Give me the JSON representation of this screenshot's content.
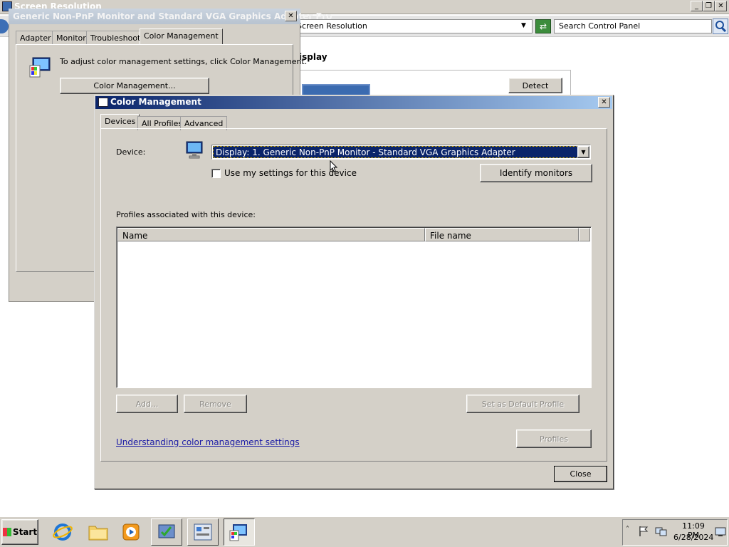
{
  "background_window": {
    "title": "Screen Resolution",
    "address": "Screen Resolution",
    "search_placeholder": "Search Control Panel",
    "heading_fragment": "isplay",
    "detect_label": "Detect"
  },
  "properties_dialog": {
    "title": "Generic Non-PnP Monitor and Standard VGA Graphics Adapter Pro",
    "tabs": [
      "Adapter",
      "Monitor",
      "Troubleshoot",
      "Color Management"
    ],
    "active_tab": "Color Management",
    "info_text": "To adjust color management settings, click Color Management.",
    "button_label": "Color Management..."
  },
  "color_management": {
    "title": "Color Management",
    "tabs": [
      "Devices",
      "All Profiles",
      "Advanced"
    ],
    "active_tab": "Devices",
    "device_label": "Device:",
    "device_value": "Display: 1. Generic Non-PnP Monitor - Standard VGA Graphics Adapter",
    "use_my_settings_label": "Use my settings for this device",
    "use_my_settings_checked": false,
    "identify_button": "Identify monitors",
    "profiles_label": "Profiles associated with this device:",
    "columns": [
      "Name",
      "File name"
    ],
    "rows": [],
    "add_button": "Add...",
    "remove_button": "Remove",
    "set_default_button": "Set as Default Profile",
    "link_text": "Understanding color management settings",
    "profiles_button": "Profiles",
    "close_button": "Close"
  },
  "taskbar": {
    "start_label": "Start",
    "pinned": [
      "internet-explorer-icon",
      "folder-icon",
      "media-player-icon"
    ],
    "apps": [
      "control-panel-checklist-icon",
      "server-manager-icon",
      "display-settings-icon"
    ],
    "clock_time": "11:09 PM",
    "clock_date": "6/28/2024"
  }
}
